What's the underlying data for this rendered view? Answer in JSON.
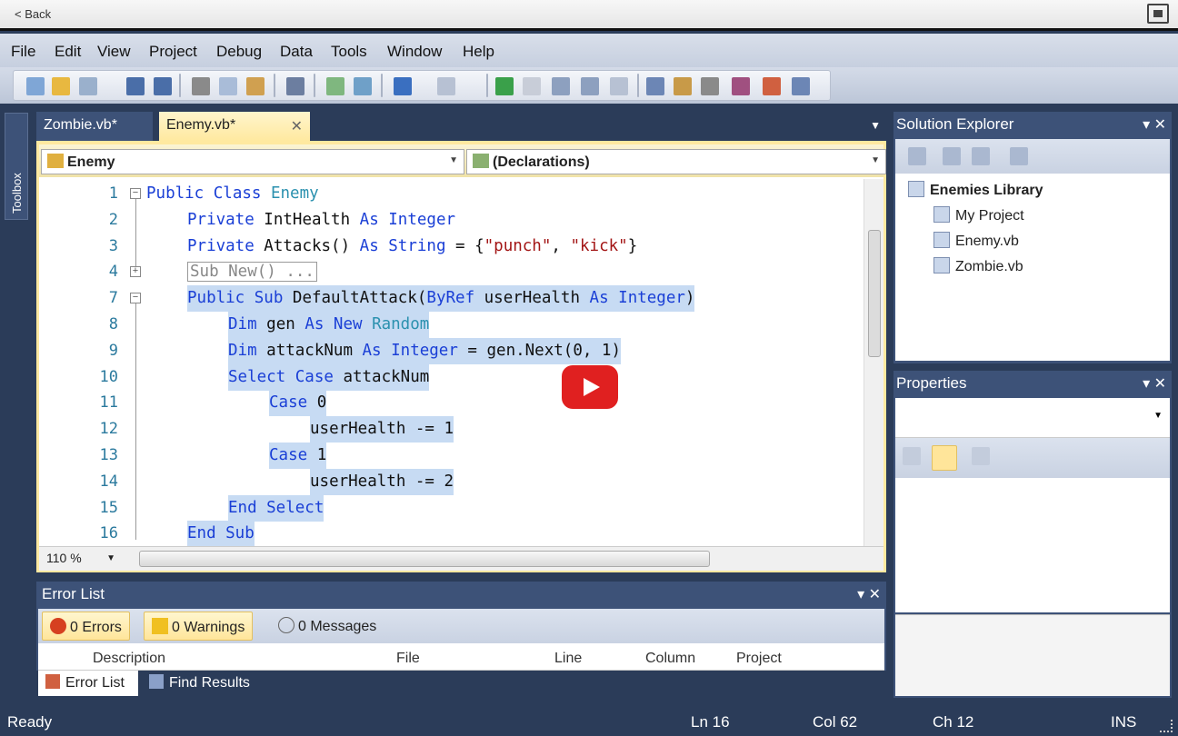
{
  "player": {
    "back_label": "< Back"
  },
  "menu": [
    "File",
    "Edit",
    "View",
    "Project",
    "Debug",
    "Data",
    "Tools",
    "Window",
    "Help"
  ],
  "tabs": {
    "inactive": "Zombie.vb*",
    "active": "Enemy.vb*"
  },
  "navbar": {
    "class_combo": "Enemy",
    "member_combo": "(Declarations)"
  },
  "code_lines": [
    {
      "num": "1",
      "parts": [
        [
          "kw",
          "Public Class "
        ],
        [
          "ty",
          "Enemy"
        ]
      ]
    },
    {
      "num": "2",
      "parts": [
        [
          "kw",
          "Private "
        ],
        [
          "",
          "IntHealth "
        ],
        [
          "kw",
          "As Integer"
        ]
      ]
    },
    {
      "num": "3",
      "parts": [
        [
          "kw",
          "Private "
        ],
        [
          "",
          "Attacks() "
        ],
        [
          "kw",
          "As String "
        ],
        [
          "",
          "= {"
        ],
        [
          "st",
          "\"punch\""
        ],
        [
          "",
          ", "
        ],
        [
          "st",
          "\"kick\""
        ],
        [
          "",
          "}"
        ]
      ]
    },
    {
      "num": "4",
      "parts": [
        [
          "gr",
          "Sub New() ..."
        ]
      ]
    },
    {
      "num": "7",
      "parts": [
        [
          "kw",
          "Public Sub "
        ],
        [
          "",
          "DefaultAttack("
        ],
        [
          "kw",
          "ByRef "
        ],
        [
          "",
          "userHealth "
        ],
        [
          "kw",
          "As Integer"
        ],
        [
          "",
          ")"
        ]
      ]
    },
    {
      "num": "8",
      "parts": [
        [
          "kw",
          "Dim "
        ],
        [
          "",
          "gen "
        ],
        [
          "kw",
          "As New "
        ],
        [
          "ty",
          "Random"
        ]
      ]
    },
    {
      "num": "9",
      "parts": [
        [
          "kw",
          "Dim "
        ],
        [
          "",
          "attackNum "
        ],
        [
          "kw",
          "As Integer "
        ],
        [
          "",
          "= gen.Next(0, 1)"
        ]
      ]
    },
    {
      "num": "10",
      "parts": [
        [
          "kw",
          "Select Case "
        ],
        [
          "",
          "attackNum"
        ]
      ]
    },
    {
      "num": "11",
      "parts": [
        [
          "kw",
          "Case "
        ],
        [
          "",
          "0"
        ]
      ]
    },
    {
      "num": "12",
      "parts": [
        [
          "",
          "userHealth -= 1"
        ]
      ]
    },
    {
      "num": "13",
      "parts": [
        [
          "kw",
          "Case "
        ],
        [
          "",
          "1"
        ]
      ]
    },
    {
      "num": "14",
      "parts": [
        [
          "",
          "userHealth -= 2"
        ]
      ]
    },
    {
      "num": "15",
      "parts": [
        [
          "kw",
          "End Select"
        ]
      ]
    },
    {
      "num": "16",
      "parts": [
        [
          "kw",
          "End Sub"
        ]
      ]
    }
  ],
  "editor": {
    "zoom": "110 %"
  },
  "solution_explorer": {
    "title": "Solution Explorer",
    "root": "Enemies Library",
    "items": [
      "My Project",
      "Enemy.vb",
      "Zombie.vb"
    ]
  },
  "properties": {
    "title": "Properties"
  },
  "error_list": {
    "title": "Error List",
    "errors": "0 Errors",
    "warnings": "0 Warnings",
    "messages": "0 Messages",
    "columns": [
      "Description",
      "File",
      "Line",
      "Column",
      "Project"
    ]
  },
  "bottom_tabs": {
    "error_list": "Error List",
    "find_results": "Find Results"
  },
  "status": {
    "ready": "Ready",
    "ln": "Ln 16",
    "col": "Col 62",
    "ch": "Ch 12",
    "mode": "INS"
  },
  "sidebar": {
    "toolbox": "Toolbox"
  },
  "colors": {
    "ide_blue": "#2b3c59",
    "tab_active": "#ffe9a0",
    "selection": "#c7dbf3",
    "keyword": "#1a3fd6",
    "string": "#a31515"
  }
}
